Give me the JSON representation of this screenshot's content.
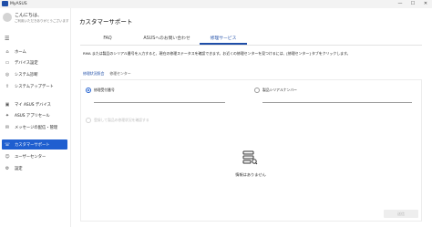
{
  "window": {
    "title": "MyASUS",
    "controls": [
      "—",
      "☐",
      "✕"
    ]
  },
  "sidebar": {
    "greeting": "こんにちは、",
    "user_note": "ご利用いただきありがとうございます",
    "menu_icon": "☰",
    "items": [
      {
        "icon": "⌂",
        "label": "ホーム"
      },
      {
        "icon": "▭",
        "label": "デバイス設定"
      },
      {
        "icon": "◎",
        "label": "システム診断"
      },
      {
        "icon": "⇪",
        "label": "システムアップデート"
      },
      {
        "icon": "▣",
        "label": "マイ ASUS デバイス"
      },
      {
        "icon": "✦",
        "label": "ASUS アプリセール"
      },
      {
        "icon": "✉",
        "label": "メッセージの配信・管理"
      },
      {
        "icon": "☏",
        "label": "カスタマーサポート"
      },
      {
        "icon": "☺",
        "label": "ユーザーセンター"
      },
      {
        "icon": "⚙",
        "label": "設定"
      }
    ]
  },
  "main": {
    "title": "カスタマーサポート",
    "tabs": [
      {
        "label": "FAQ"
      },
      {
        "label": "ASUSへのお問い合わせ"
      },
      {
        "label": "修理サービス"
      }
    ],
    "repair_note": "RMA または製品のシリアル番号を入力すると、現在の修理ステータスを確認できます。お近くの修理センターを見つけるには、[修理センター] タブをクリックします。",
    "subtabs": [
      {
        "label": "修理状況照会"
      },
      {
        "label": "修理センター"
      }
    ],
    "form": {
      "option_rma": "修理受付番号",
      "option_serial": "製品シリアルナンバー",
      "rma_value": "",
      "serial_value": "",
      "remember_label": "登録して製品の修理状況を確認する"
    },
    "empty_message": "情報はありません",
    "search_button": "送信"
  },
  "colors": {
    "accent": "#1f5fd0",
    "active_tab": "#1f4ea8"
  }
}
